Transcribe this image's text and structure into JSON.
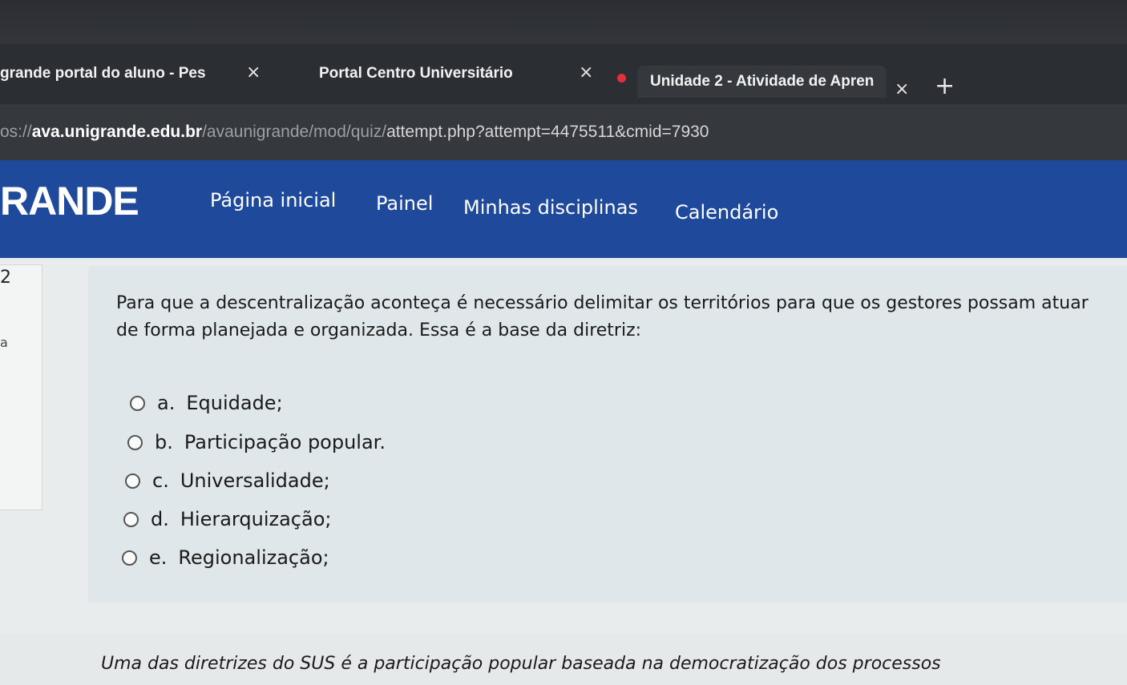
{
  "browser": {
    "tabs": [
      {
        "title": "grande portal do aluno - Pes"
      },
      {
        "title": "Portal Centro Universitário"
      },
      {
        "title": "Unidade 2 - Atividade de Apren"
      }
    ],
    "close_glyph": "×",
    "new_tab_glyph": "+",
    "url": {
      "scheme": "os://",
      "host": "ava.unigrande.edu.br",
      "path": "/avaunigrande/mod/quiz/",
      "query": "attempt.php?attempt=4475511&cmid=7930"
    }
  },
  "site": {
    "brand": "RANDE",
    "nav": [
      "Página inicial",
      "Painel",
      "Minhas disciplinas",
      "Calendário"
    ]
  },
  "question": {
    "number": "2",
    "state_fragment": "a",
    "text": "Para que a descentralização aconteça é necessário delimitar os territórios para que os gestores possam atuar de forma planejada e organizada. Essa é a base da diretriz:",
    "options": [
      {
        "letter": "a.",
        "label": "Equidade;"
      },
      {
        "letter": "b.",
        "label": "Participação popular."
      },
      {
        "letter": "c.",
        "label": "Universalidade;"
      },
      {
        "letter": "d.",
        "label": "Hierarquização;"
      },
      {
        "letter": "e.",
        "label": "Regionalização;"
      }
    ]
  },
  "feedback": {
    "text": "Uma das diretrizes do SUS é a participação popular baseada na democratização dos processos"
  }
}
